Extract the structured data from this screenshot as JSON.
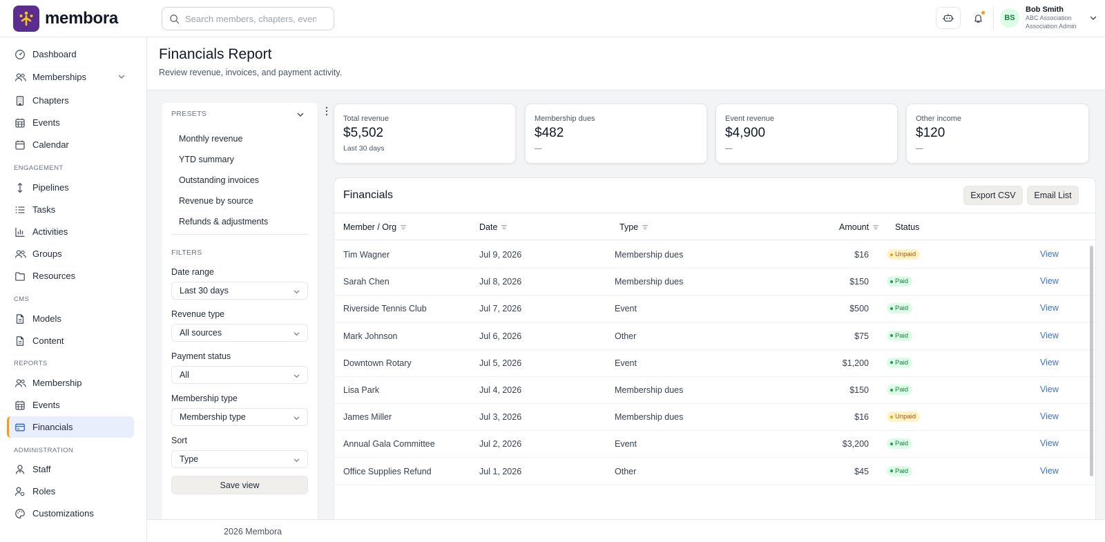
{
  "app": {
    "brand": "membora",
    "search_placeholder": "Search members, chapters, events...",
    "user": {
      "initials": "BS",
      "name": "Bob Smith",
      "org": "ABC Association",
      "role": "Association Admin"
    }
  },
  "sidebar": {
    "items_top": [
      {
        "label": "Dashboard",
        "icon": "dashboard-icon"
      },
      {
        "label": "Memberships",
        "icon": "users-icon"
      },
      {
        "label": "Chapters",
        "icon": "building-icon"
      },
      {
        "label": "Events",
        "icon": "calendar-grid-icon"
      },
      {
        "label": "Calendar",
        "icon": "calendar-icon"
      }
    ],
    "section_engagement": "ENGAGEMENT",
    "items_engagement": [
      {
        "label": "Pipelines",
        "icon": "arrows-vertical-icon"
      },
      {
        "label": "Tasks",
        "icon": "list-icon"
      },
      {
        "label": "Activities",
        "icon": "bar-chart-icon"
      },
      {
        "label": "Groups",
        "icon": "users-icon"
      },
      {
        "label": "Resources",
        "icon": "folder-icon"
      }
    ],
    "section_cms": "CMS",
    "items_cms": [
      {
        "label": "Models",
        "icon": "document-icon"
      },
      {
        "label": "Content",
        "icon": "document-icon"
      }
    ],
    "section_reports": "REPORTS",
    "items_reports": [
      {
        "label": "Membership",
        "icon": "users-icon"
      },
      {
        "label": "Events",
        "icon": "calendar-grid-icon"
      },
      {
        "label": "Financials",
        "icon": "credit-card-icon"
      }
    ],
    "section_admin": "ADMINISTRATION",
    "items_admin": [
      {
        "label": "Staff",
        "icon": "user-tie-icon"
      },
      {
        "label": "Roles",
        "icon": "user-key-icon"
      },
      {
        "label": "Customizations",
        "icon": "palette-icon"
      }
    ]
  },
  "page": {
    "title": "Financials Report",
    "subtitle": "Review revenue, invoices, and payment activity.",
    "footer": "2026 Membora"
  },
  "panel": {
    "presets_label": "PRESETS",
    "presets": [
      "Monthly revenue",
      "YTD summary",
      "Outstanding invoices",
      "Revenue by source",
      "Refunds & adjustments"
    ],
    "filters_label": "FILTERS",
    "filters": [
      {
        "label": "Date range",
        "value": "Last 30 days"
      },
      {
        "label": "Revenue type",
        "value": "All sources"
      },
      {
        "label": "Payment status",
        "value": "All"
      },
      {
        "label": "Membership type",
        "value": "Membership type"
      },
      {
        "label": "Sort",
        "value": "Type"
      }
    ],
    "save_label": "Save view"
  },
  "kpis": [
    {
      "label": "Total revenue",
      "value": "$5,502",
      "sub": "Last 30 days"
    },
    {
      "label": "Membership dues",
      "value": "$482",
      "sub": "—"
    },
    {
      "label": "Event revenue",
      "value": "$4,900",
      "sub": "—"
    },
    {
      "label": "Other income",
      "value": "$120",
      "sub": "—"
    }
  ],
  "table": {
    "title": "Financials",
    "export_label": "Export CSV",
    "email_label": "Email List",
    "columns": {
      "member": "Member / Org",
      "date": "Date",
      "type": "Type",
      "amount": "Amount",
      "status": "Status"
    },
    "view_label": "View",
    "rows": [
      {
        "member": "Tim Wagner",
        "date": "Jul 9, 2026",
        "type": "Membership dues",
        "amount": "$16",
        "status": "Unpaid"
      },
      {
        "member": "Sarah Chen",
        "date": "Jul 8, 2026",
        "type": "Membership dues",
        "amount": "$150",
        "status": "Paid"
      },
      {
        "member": "Riverside Tennis Club",
        "date": "Jul 7, 2026",
        "type": "Event",
        "amount": "$500",
        "status": "Paid"
      },
      {
        "member": "Mark Johnson",
        "date": "Jul 6, 2026",
        "type": "Other",
        "amount": "$75",
        "status": "Paid"
      },
      {
        "member": "Downtown Rotary",
        "date": "Jul 5, 2026",
        "type": "Event",
        "amount": "$1,200",
        "status": "Paid"
      },
      {
        "member": "Lisa Park",
        "date": "Jul 4, 2026",
        "type": "Membership dues",
        "amount": "$150",
        "status": "Paid"
      },
      {
        "member": "James Miller",
        "date": "Jul 3, 2026",
        "type": "Membership dues",
        "amount": "$16",
        "status": "Unpaid"
      },
      {
        "member": "Annual Gala Committee",
        "date": "Jul 2, 2026",
        "type": "Event",
        "amount": "$3,200",
        "status": "Paid"
      },
      {
        "member": "Office Supplies Refund",
        "date": "Jul 1, 2026",
        "type": "Other",
        "amount": "$45",
        "status": "Paid"
      }
    ]
  }
}
